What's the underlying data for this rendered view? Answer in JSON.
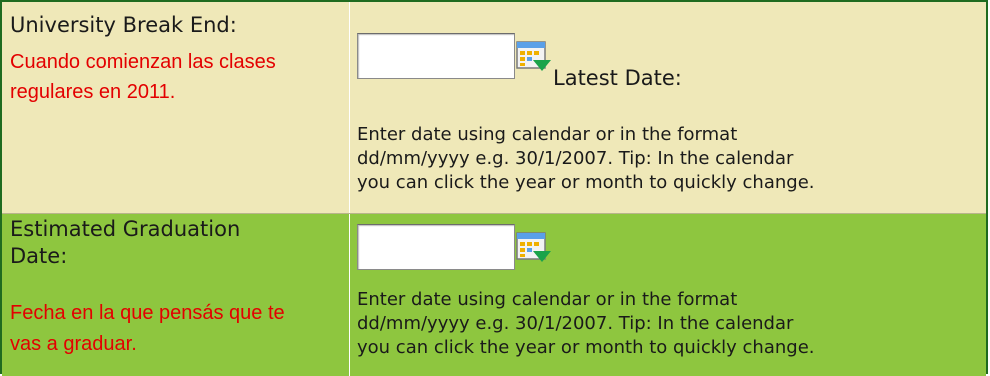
{
  "rows": [
    {
      "label": "University Break End:",
      "note_line1": "Cuando comienzan las clases",
      "note_line2": "regulares en 2011.",
      "input_value": "",
      "extra_label": "Latest Date:",
      "help_line1": "Enter date using calendar or in the format",
      "help_line2": "dd/mm/yyyy e.g. 30/1/2007. Tip: In the calendar",
      "help_line3": "you can click the year or month to quickly change."
    },
    {
      "label_line1": "Estimated Graduation",
      "label_line2": "Date:",
      "note_line1": "Fecha en la que pensás que te",
      "note_line2": "vas a graduar.",
      "input_value": "",
      "help_line1": "Enter date using calendar or in the format",
      "help_line2": "dd/mm/yyyy e.g. 30/1/2007. Tip: In the calendar",
      "help_line3": "you can click the year or month to quickly change."
    }
  ],
  "icons": {
    "calendar": "calendar-icon"
  },
  "colors": {
    "row1_bg": "#efe8b8",
    "row2_bg": "#8ec63f",
    "note_text": "#e30000",
    "border": "#1f6b1f"
  }
}
